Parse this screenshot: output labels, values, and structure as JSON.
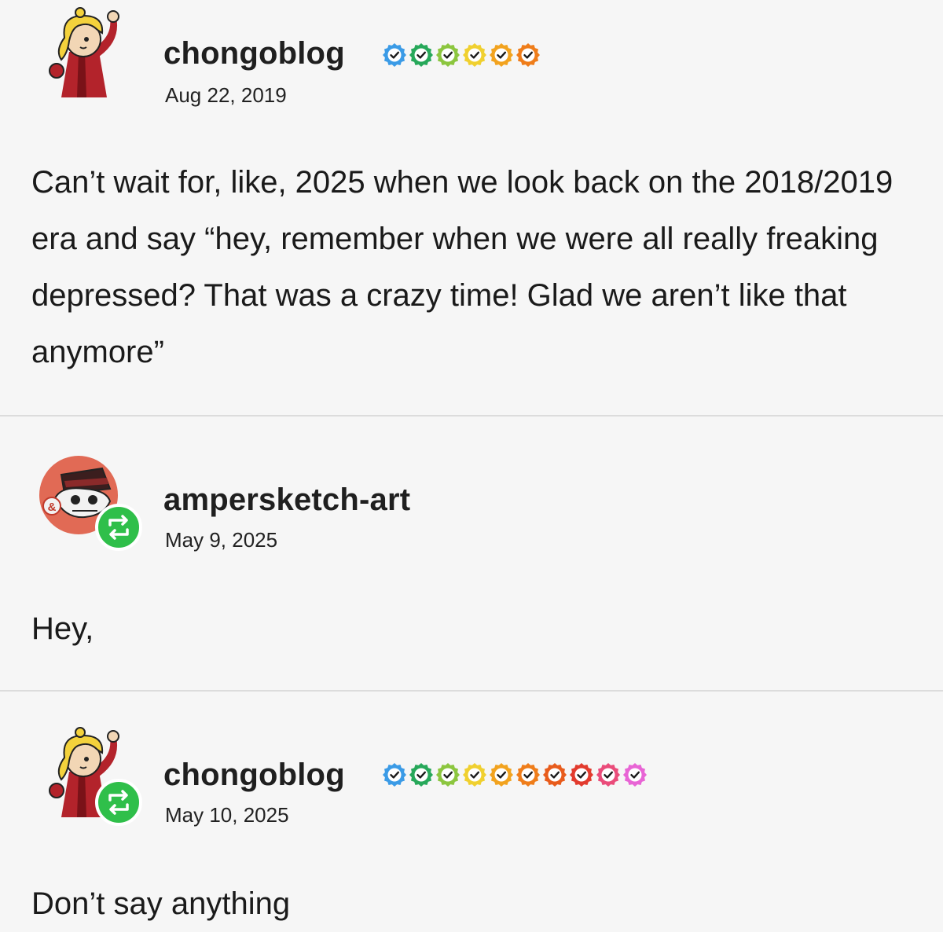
{
  "posts": [
    {
      "username": "chongoblog",
      "date": "Aug 22, 2019",
      "body": "Can’t wait for, like, 2025 when we look back on the 2018/2019 era and say “hey, remember when we were all really freaking depressed? That was a crazy time! Glad we aren’t like that anymore”",
      "badge_colors": [
        "#3b9be6",
        "#27a85a",
        "#8cc63f",
        "#f0d030",
        "#f2a31f",
        "#ef7d1a"
      ]
    },
    {
      "username": "ampersketch-art",
      "date": "May 9, 2025",
      "body": "Hey,",
      "avatar_badge_text": "&"
    },
    {
      "username": "chongoblog",
      "date": "May 10, 2025",
      "body": "Don’t say anything",
      "badge_colors": [
        "#3b9be6",
        "#27a85a",
        "#8cc63f",
        "#f0d030",
        "#f2a31f",
        "#ef7d1a",
        "#e85c1c",
        "#e23b2e",
        "#ea4c7a",
        "#e865d5"
      ]
    }
  ],
  "colors": {
    "reblog_green": "#2fbf4a",
    "background": "#f6f6f6",
    "divider": "#dcdcdc"
  },
  "icons": {
    "reblog": "reblog-icon",
    "badge": "verified-check-icon"
  }
}
